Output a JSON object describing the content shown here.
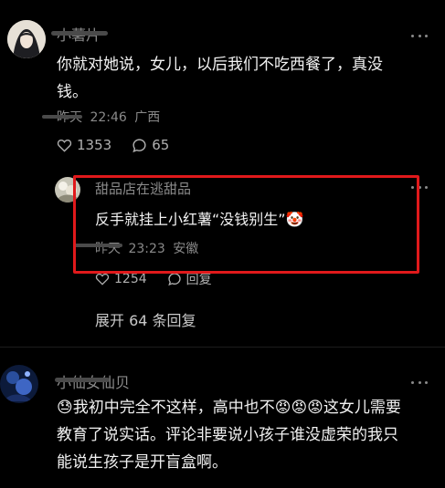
{
  "comment1": {
    "username": "小薯片",
    "text": "你就对她说，女儿，以后我们不吃西餐了，真没钱。",
    "time_prefix": "昨天",
    "time": "22:46",
    "location": "广西",
    "likes": "1353",
    "replies_count": "65"
  },
  "reply1": {
    "username": "甜品店在逃甜品",
    "text": "反手就挂上小红薯“没钱别生”🤡",
    "time_prefix": "昨天",
    "time": "23:23",
    "location": "安徽",
    "likes": "1254",
    "reply_label": "回复"
  },
  "expand_replies": "展开 64 条回复",
  "comment2": {
    "username": "小仙女仙贝",
    "text": "😓我初中完全不这样，高中也不😡😡😡这女儿需要教育了说实话。评论非要说小孩子谁没虚荣的我只能说生孩子是开盲盒啊。"
  },
  "colors": {
    "background": "#000000",
    "highlight": "#e0191b",
    "secondary_text": "#8a8a8a"
  },
  "icons": {
    "like": "heart-icon",
    "comment": "comment-bubble-icon",
    "more": "more-dots-icon"
  }
}
